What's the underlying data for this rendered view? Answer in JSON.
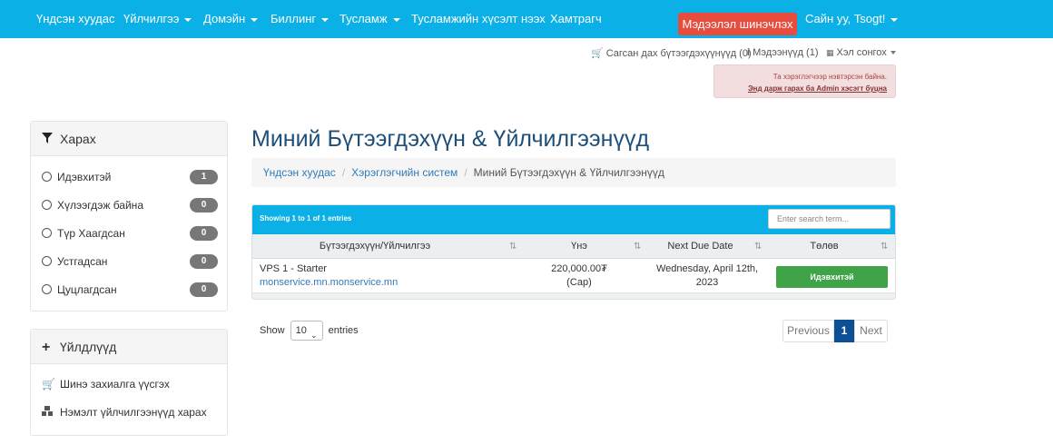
{
  "nav": {
    "items": [
      {
        "label": "Үндсэн хуудас",
        "dropdown": false
      },
      {
        "label": "Үйлчилгээ",
        "dropdown": true
      },
      {
        "label": "Домэйн",
        "dropdown": true
      },
      {
        "label": "Биллинг",
        "dropdown": true
      },
      {
        "label": "Тусламж",
        "dropdown": true
      },
      {
        "label": "Тусламжийн хүсэлт нээх",
        "dropdown": false
      },
      {
        "label": "Хамтрагч",
        "dropdown": false
      }
    ],
    "update_button": "Мэдээлэл шинэчлэх",
    "greeting": "Сайн уу, Tsogt!",
    "accent_color": "#0ab0e6"
  },
  "secondary": {
    "cart": "Сагсан дах бүтээгдэхүүнүүд (0)",
    "notifications": "Мэдээнүүд (1)",
    "language": "Хэл сонгох"
  },
  "admin_alert": {
    "text": "Та хэрэглэгчээр нэвтэрсэн байна.",
    "link": "Энд дарж гарах ба Admin хэсэгт буцна"
  },
  "sidebar": {
    "filter_title": "Харах",
    "filters": [
      {
        "label": "Идэвхитэй",
        "count": "1"
      },
      {
        "label": "Хүлээгдэж байна",
        "count": "0"
      },
      {
        "label": "Түр Хаагдсан",
        "count": "0"
      },
      {
        "label": "Устгадсан",
        "count": "0"
      },
      {
        "label": "Цуцлагдсан",
        "count": "0"
      }
    ],
    "actions_title": "Үйлдлүүд",
    "actions": [
      {
        "label": "Шинэ захиалга үүсгэх",
        "icon": "cart-icon"
      },
      {
        "label": "Нэмэлт үйлчилгээнүүд харах",
        "icon": "cubes-icon"
      }
    ]
  },
  "main": {
    "title": "Миний Бүтээгдэхүүн & Үйлчилгээнүүд",
    "breadcrumb": [
      "Үндсэн хуудас",
      "Хэрэглэгчийн систем",
      "Миний Бүтээгдэхүүн & Үйлчилгээнүүд"
    ],
    "table": {
      "info": "Showing 1 to 1 of 1 entries",
      "search_placeholder": "Enter search term...",
      "headers": [
        "Бүтээгдэхүүн/Үйлчилгээ",
        "Үнэ",
        "Next Due Date",
        "Төлөв"
      ],
      "rows": [
        {
          "product": "VPS 1 - Starter",
          "domain": "monservice.mn.monservice.mn",
          "price": "220,000.00₮",
          "cycle": "(Сар)",
          "due_date_line1": "Wednesday, April 12th,",
          "due_date_line2": "2023",
          "status": "Идэвхитэй"
        }
      ]
    },
    "length": {
      "show": "Show",
      "value": "10",
      "entries": "entries"
    },
    "pagination": {
      "previous": "Previous",
      "page": "1",
      "next": "Next"
    }
  }
}
